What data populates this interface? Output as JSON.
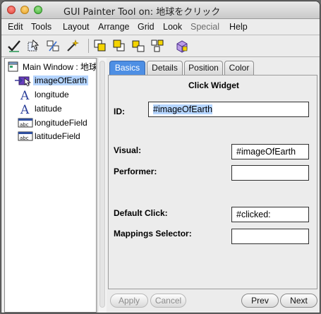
{
  "window": {
    "title": "GUI Painter Tool on: 地球をクリック"
  },
  "menu": [
    "Edit",
    "Tools",
    "Layout",
    "Arrange",
    "Grid",
    "Look",
    "Special",
    "Help"
  ],
  "toolbar": {
    "icons": [
      "check-tool-icon",
      "select-tool-icon",
      "group-tool-icon",
      "wand-tool-icon",
      "bring-front-icon",
      "send-back-icon",
      "align-icon",
      "distribute-icon",
      "widget-cube-icon"
    ]
  },
  "tree": {
    "items": [
      {
        "label": "Main Window : 地球",
        "icon": "window-icon"
      },
      {
        "label": "imageOfEarth",
        "icon": "action-button-icon",
        "selected": true
      },
      {
        "label": "longitude",
        "icon": "label-icon"
      },
      {
        "label": "latitude",
        "icon": "label-icon"
      },
      {
        "label": "longitudeField",
        "icon": "input-field-icon"
      },
      {
        "label": "latitudeField",
        "icon": "input-field-icon"
      }
    ]
  },
  "tabs": [
    "Basics",
    "Details",
    "Position",
    "Color"
  ],
  "active_tab": "Basics",
  "form": {
    "heading": "Click Widget",
    "id_label": "ID:",
    "id_value": "#imageOfEarth",
    "visual_label": "Visual:",
    "visual_value": "#imageOfEarth",
    "performer_label": "Performer:",
    "performer_value": "",
    "default_click_label": "Default Click:",
    "default_click_value": "#clicked:",
    "mappings_label": "Mappings Selector:",
    "mappings_value": ""
  },
  "buttons": {
    "apply": "Apply",
    "cancel": "Cancel",
    "prev": "Prev",
    "next": "Next"
  }
}
